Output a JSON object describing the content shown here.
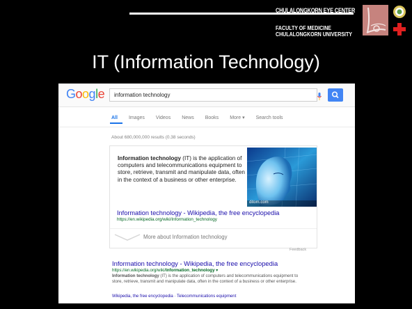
{
  "header": {
    "eye_center": "CHULALONGKORN EYE CENTER",
    "faculty_line1": "FACULTY OF MEDICINE",
    "faculty_line2": "CHULALONGKORN UNIVERSITY"
  },
  "slide": {
    "title": "IT (Information Technology)"
  },
  "google": {
    "logo": [
      "G",
      "o",
      "o",
      "g",
      "l",
      "e"
    ],
    "logo_colors": [
      "#4285f4",
      "#ea4335",
      "#fbbc05",
      "#4285f4",
      "#34a853",
      "#ea4335"
    ],
    "query": "information technology",
    "tabs": [
      "All",
      "Images",
      "Videos",
      "News",
      "Books",
      "More ▾",
      "Search tools"
    ],
    "stats": "About 680,000,000 results (0.38 seconds)",
    "knowledge_card": {
      "term": "Information technology",
      "definition": " (IT) is the application of computers and telecommunications equipment to store, retrieve, transmit and manipulate data, often in the context of a business or other enterprise.",
      "image_credit": "ditom.com",
      "link_title": "Information technology - Wikipedia, the free encyclopedia",
      "link_url": "https://en.wikipedia.org/wiki/Information_technology",
      "more_about": "More about Information technology",
      "feedback": "Feedback"
    },
    "result": {
      "title": "Information technology - Wikipedia, the free encyclopedia",
      "url_prefix": "https://en.wikipedia.org/wiki/",
      "url_bold": "Information_technology",
      "url_arrow": " ▾",
      "snippet_bold": "Information technology",
      "snippet": " (IT) is the application of computers and telecommunications equipment to store, retrieve, transmit and manipulate data, often in the context of a business or other enterprise.",
      "sitelinks": "Wikipedia, the free encyclopedia  ·  Telecommunications equipment"
    }
  }
}
